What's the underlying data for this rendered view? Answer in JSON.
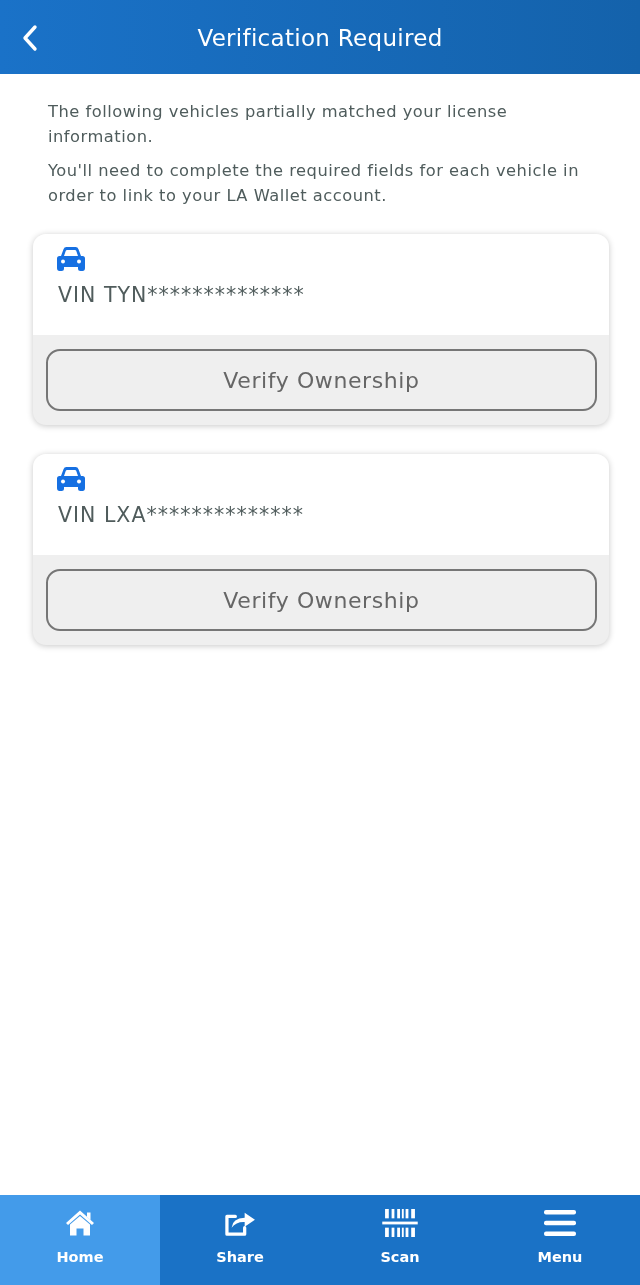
{
  "header": {
    "title": "Verification Required"
  },
  "intro": [
    "The following vehicles partially matched your license information.",
    "You'll need to complete the required fields for each vehicle in order to link to your LA Wallet account."
  ],
  "vehicles": [
    {
      "vin": "VIN TYN**************",
      "button": "Verify Ownership"
    },
    {
      "vin": "VIN LXA**************",
      "button": "Verify Ownership"
    }
  ],
  "bottom_nav": [
    {
      "label": "Home",
      "kind": "home",
      "selected": true
    },
    {
      "label": "Share",
      "kind": "share",
      "selected": false
    },
    {
      "label": "Scan",
      "kind": "scan",
      "selected": false
    },
    {
      "label": "Menu",
      "kind": "menu",
      "selected": false
    }
  ]
}
